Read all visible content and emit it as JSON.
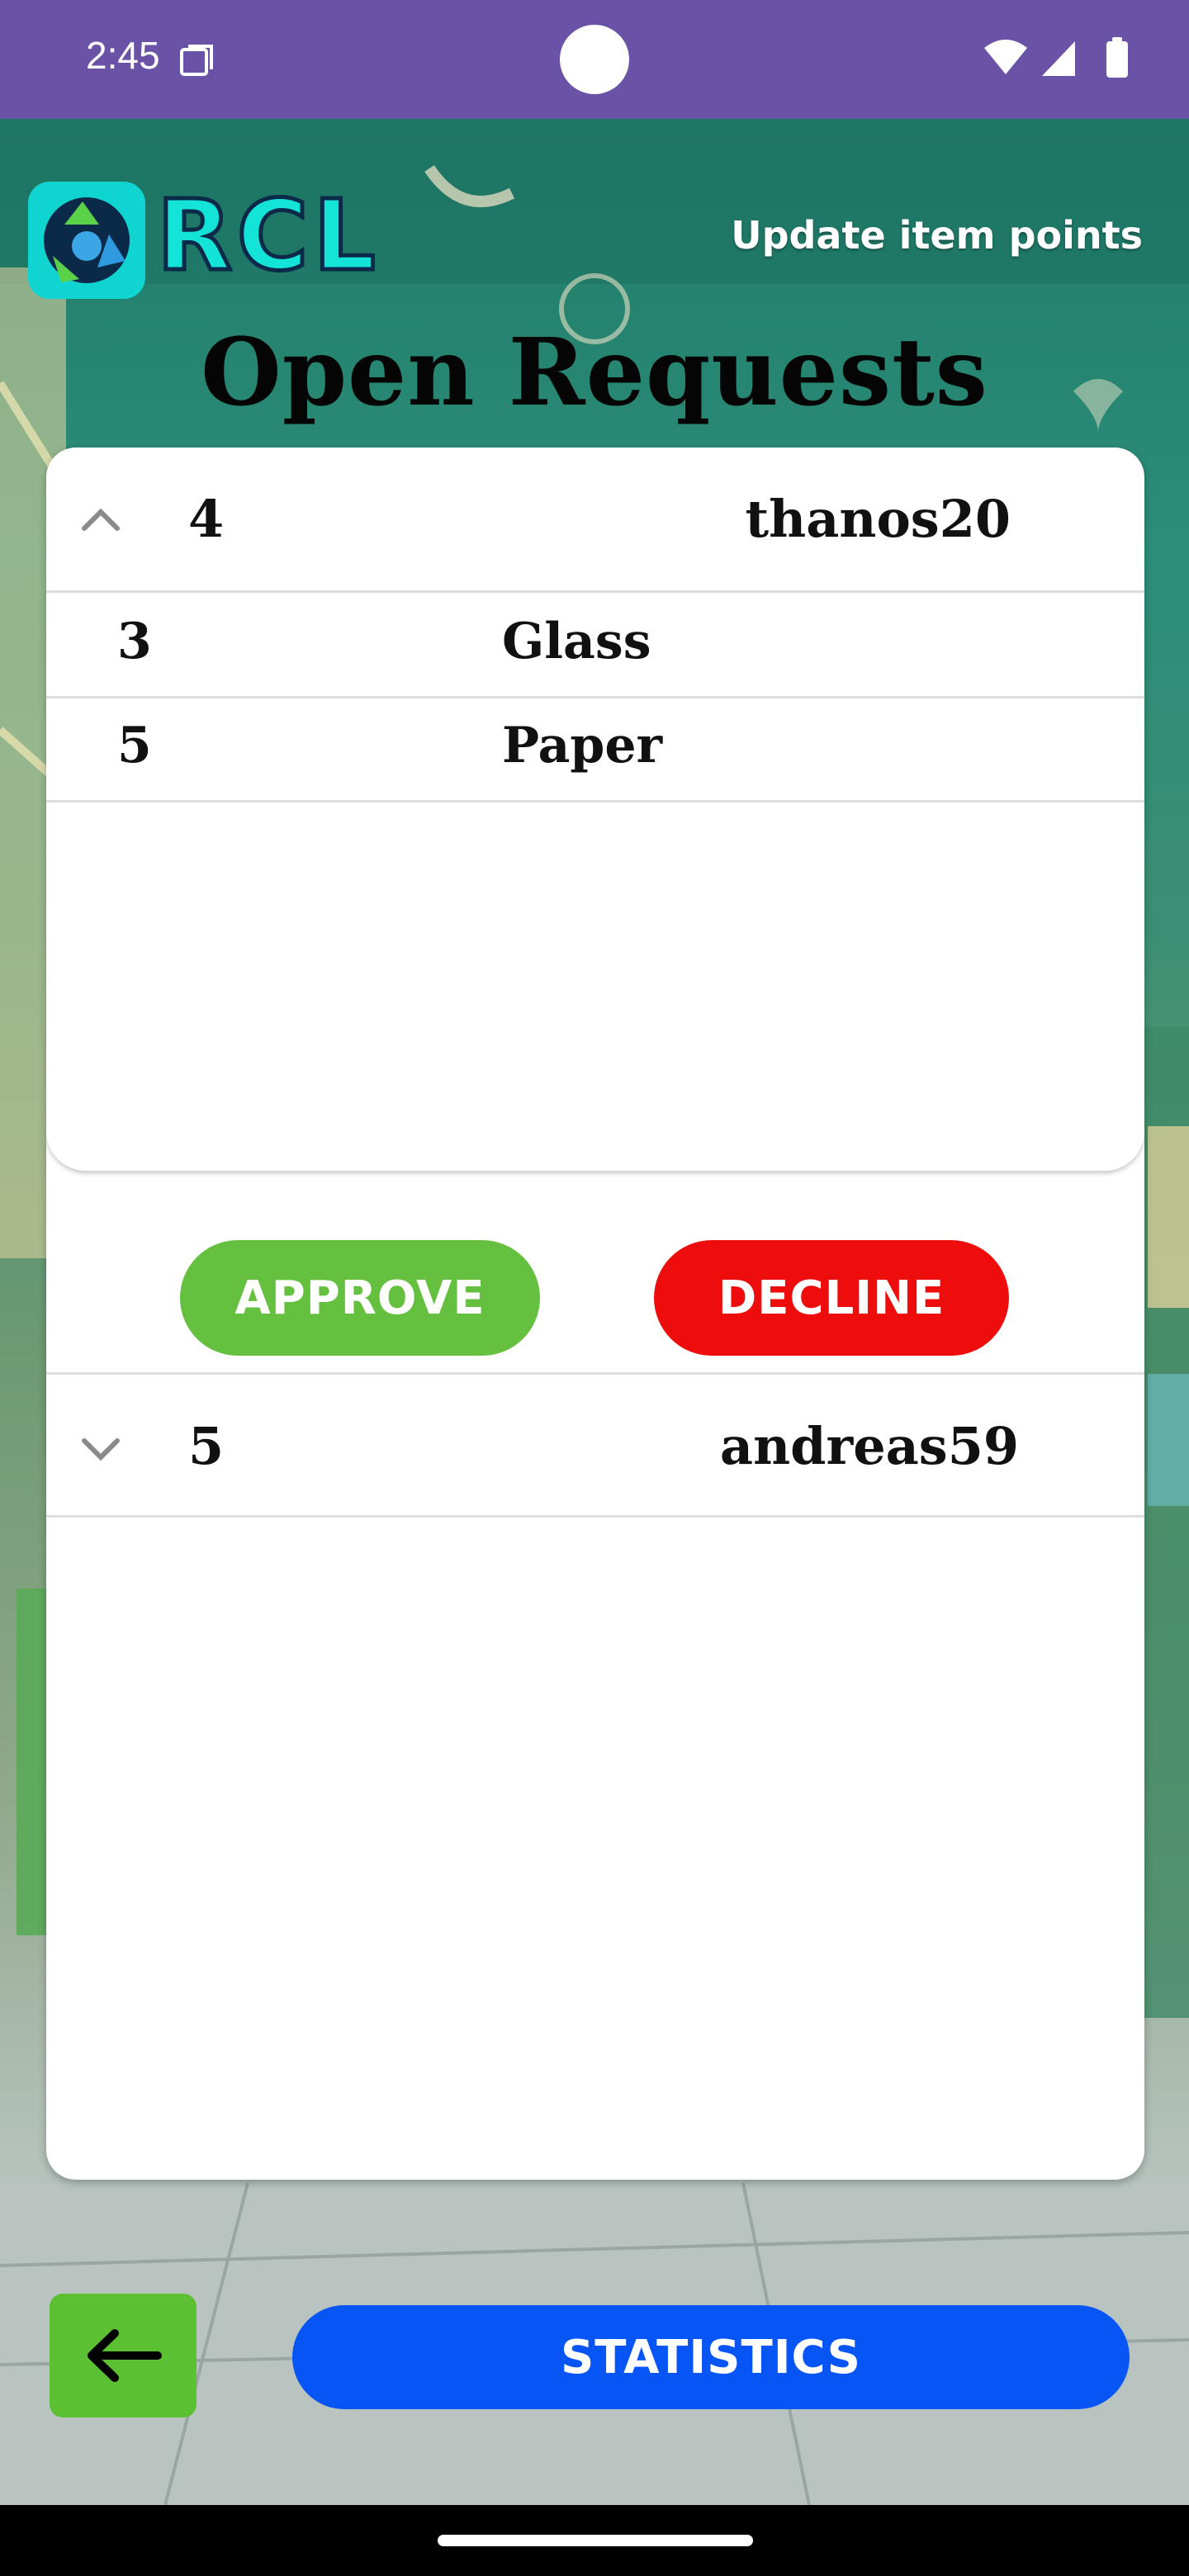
{
  "status_bar": {
    "time": "2:45",
    "icons": [
      "screen-record-icon",
      "wifi-icon",
      "signal-icon",
      "battery-icon"
    ]
  },
  "header": {
    "logo_text": "RCL",
    "logo_icon": "recycle-logo-icon",
    "update_link": "Update item points",
    "title": "Open Requests"
  },
  "requests": [
    {
      "id": "4",
      "user": "thanos20",
      "expanded": true,
      "items": [
        {
          "qty": "3",
          "name": "Glass"
        },
        {
          "qty": "5",
          "name": "Paper"
        }
      ],
      "approve_label": "APPROVE",
      "decline_label": "DECLINE"
    },
    {
      "id": "5",
      "user": "andreas59",
      "expanded": false
    }
  ],
  "footer": {
    "back_icon": "arrow-left-icon",
    "statistics_label": "STATISTICS"
  },
  "colors": {
    "status_bar": "#6a53a6",
    "approve": "#64c03e",
    "decline": "#ee0d0d",
    "statistics": "#0855f5",
    "back": "#5cc132",
    "logo": "#14e3d8"
  }
}
